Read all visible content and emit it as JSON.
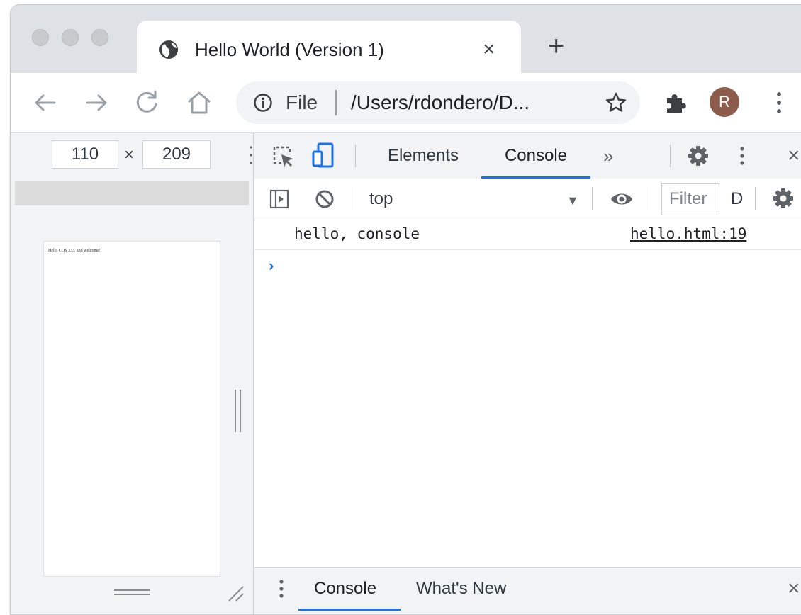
{
  "tab": {
    "title": "Hello World (Version 1)",
    "close_glyph": "×",
    "new_tab_glyph": "+"
  },
  "address_bar": {
    "scheme_label": "File",
    "url": "/Users/rdondero/D..."
  },
  "profile": {
    "initial": "R",
    "color": "#8d5b4c"
  },
  "device_toolbar": {
    "width_value": "110",
    "times_glyph": "×",
    "height_value": "209"
  },
  "page_preview": {
    "text": "Hello COS 333, and welcome!"
  },
  "devtools": {
    "tabs": [
      {
        "label": "Elements",
        "active": false
      },
      {
        "label": "Console",
        "active": true
      }
    ],
    "more_tabs_glyph": "»",
    "close_glyph": "×",
    "accent_color": "#1a73e8",
    "console_toolbar": {
      "context": "top",
      "context_caret": "▼",
      "filter_placeholder": "Filter",
      "levels_label": "D"
    },
    "console_log": [
      {
        "message": "hello, console",
        "source": "hello.html:19"
      }
    ],
    "prompt_glyph": "›",
    "drawer": {
      "tabs": [
        {
          "label": "Console",
          "active": true
        },
        {
          "label": "What's New",
          "active": false
        }
      ],
      "close_glyph": "×"
    }
  },
  "icons": {
    "tab": "globe-icon",
    "nav": [
      "back-arrow-icon",
      "forward-arrow-icon",
      "reload-icon",
      "home-icon"
    ],
    "address": [
      "info-icon",
      "star-icon"
    ],
    "toolbar": [
      "puzzle-icon",
      "vertical-dots-icon"
    ],
    "devtools": [
      "inspect-element-icon",
      "device-toggle-icon",
      "gear-icon",
      "sidebar-toggle-icon",
      "clear-console-icon",
      "eye-icon"
    ]
  }
}
